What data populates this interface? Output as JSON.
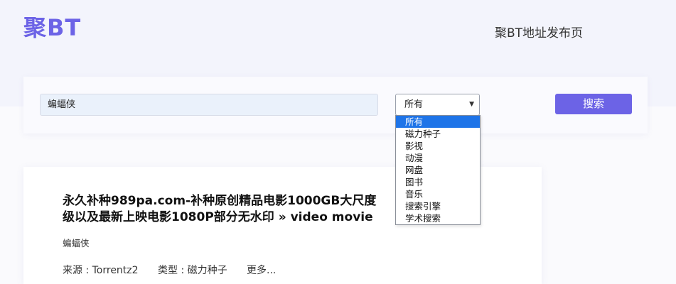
{
  "header": {
    "logo": "聚BT",
    "link": "聚BT地址发布页"
  },
  "search": {
    "query": "蝙蝠侠",
    "selected_category": "所有",
    "button_label": "搜索",
    "categories": [
      "所有",
      "磁力种子",
      "影视",
      "动漫",
      "网盘",
      "图书",
      "音乐",
      "搜索引擎",
      "学术搜索"
    ]
  },
  "result": {
    "title_line1": "永久补种989pa.com-补种原创精品电影1000GB大尺度",
    "title_line2": "级以及最新上映电影1080P部分无水印 » video movie",
    "keyword": "蝙蝠侠",
    "source": "来源 : Torrentz2",
    "type": "类型 : 磁力种子",
    "more": "更多..."
  }
}
